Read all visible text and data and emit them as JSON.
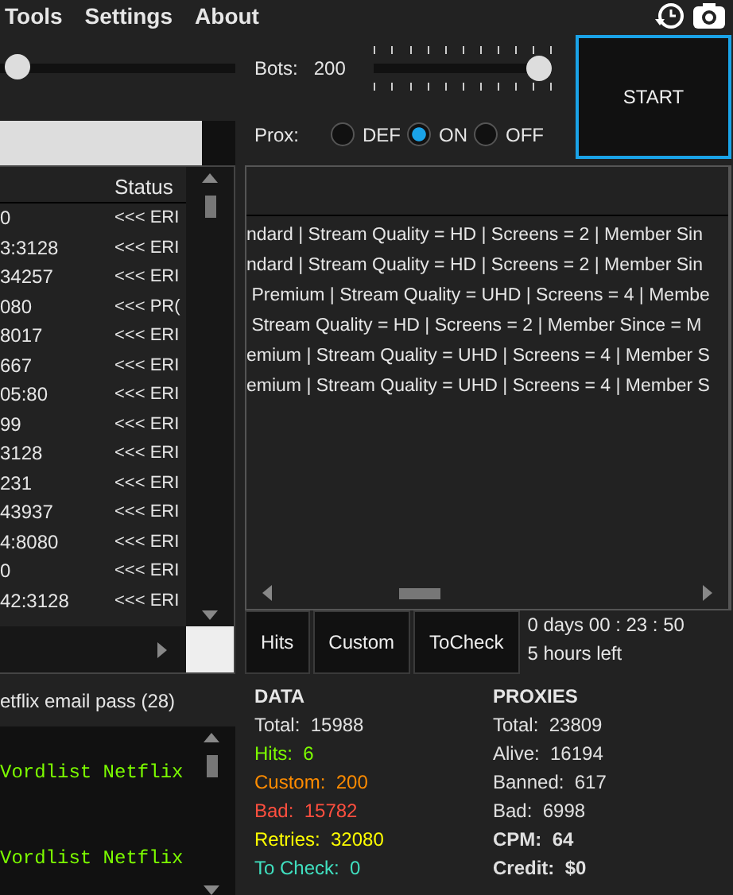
{
  "menu": [
    "Tools",
    "Settings",
    "About"
  ],
  "threads_slider": {
    "level": 0.02
  },
  "bots": {
    "label": "Bots:",
    "value": "200",
    "level": 1.0
  },
  "start_button": "START",
  "progress": {
    "level": 0.86
  },
  "proxy_mode": {
    "label": "Prox:",
    "options": [
      {
        "label": "DEF",
        "selected": false
      },
      {
        "label": "ON",
        "selected": true
      },
      {
        "label": "OFF",
        "selected": false
      }
    ]
  },
  "proxy_table": {
    "columns": [
      "Status"
    ],
    "rows": [
      {
        "proxy": "0",
        "status": "<<< ERI"
      },
      {
        "proxy": "3:3128",
        "status": "<<< ERI"
      },
      {
        "proxy": "34257",
        "status": "<<< ERI"
      },
      {
        "proxy": "080",
        "status": "<<< PR("
      },
      {
        "proxy": "8017",
        "status": "<<< ERI"
      },
      {
        "proxy": "667",
        "status": "<<< ERI"
      },
      {
        "proxy": "05:80",
        "status": "<<< ERI"
      },
      {
        "proxy": "99",
        "status": "<<< ERI"
      },
      {
        "proxy": "3128",
        "status": "<<< ERI"
      },
      {
        "proxy": "231",
        "status": "<<< ERI"
      },
      {
        "proxy": "43937",
        "status": "<<< ERI"
      },
      {
        "proxy": "4:8080",
        "status": "<<< ERI"
      },
      {
        "proxy": "0",
        "status": "<<< ERI"
      },
      {
        "proxy": "42:3128",
        "status": "<<< ERI"
      }
    ]
  },
  "hits_list": [
    "ndard | Stream Quality = HD | Screens = 2 | Member Sin",
    "ndard | Stream Quality = HD | Screens = 2 | Member Sin",
    " Premium | Stream Quality = UHD | Screens = 4 | Membe",
    " Stream Quality = HD | Screens = 2 | Member Since = M",
    "emium | Stream Quality = UHD | Screens = 4 | Member S",
    "emium | Stream Quality = UHD | Screens = 4 | Member S"
  ],
  "result_tabs": [
    "Hits",
    "Custom",
    "ToCheck"
  ],
  "timer": {
    "elapsed": "0  days  00  :  23  :  50",
    "remaining": "5 hours left"
  },
  "wordlist": {
    "name": "etflix email pass (28)",
    "log": [
      "Vordlist Netflix",
      "Vordlist Netflix"
    ]
  },
  "data_stats": {
    "title": "DATA",
    "items": [
      {
        "label": "Total:",
        "value": "15988",
        "color": "#e0e0e0"
      },
      {
        "label": "Hits:",
        "value": "6",
        "color": "#7cfc00"
      },
      {
        "label": "Custom:",
        "value": "200",
        "color": "#ff8c00"
      },
      {
        "label": "Bad:",
        "value": "15782",
        "color": "#ff4f3f"
      },
      {
        "label": "Retries:",
        "value": "32080",
        "color": "#ffff00"
      },
      {
        "label": "To Check:",
        "value": "0",
        "color": "#40e0c0"
      }
    ]
  },
  "proxy_stats": {
    "title": "PROXIES",
    "items": [
      {
        "label": "Total:",
        "value": "23809",
        "bold": false
      },
      {
        "label": "Alive:",
        "value": "16194",
        "bold": false
      },
      {
        "label": "Banned:",
        "value": "617",
        "bold": false
      },
      {
        "label": "Bad:",
        "value": "6998",
        "bold": false
      },
      {
        "label": "CPM:",
        "value": "64",
        "bold": true
      },
      {
        "label": "Credit:",
        "value": "$0",
        "bold": true
      }
    ]
  }
}
